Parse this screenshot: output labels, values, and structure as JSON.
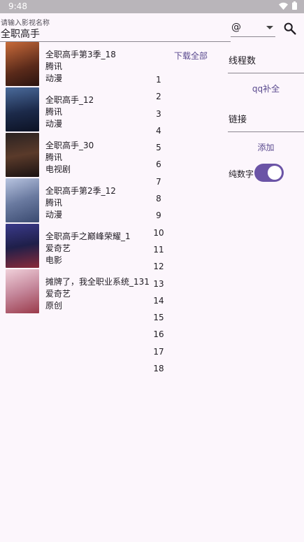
{
  "status_bar": {
    "time": "9:48"
  },
  "search": {
    "label": "请输入影视名称",
    "value": "全职高手"
  },
  "dropdown": {
    "selected": "@"
  },
  "download_all_label": "下载全部",
  "results": [
    {
      "title": "全职高手第3季_18",
      "source": "腾讯",
      "type": "动漫",
      "poster_color": "#7a3a22"
    },
    {
      "title": "全职高手_12",
      "source": "腾讯",
      "type": "动漫",
      "poster_color": "#1c2a4a"
    },
    {
      "title": "全职高手_30",
      "source": "腾讯",
      "type": "电视剧",
      "poster_color": "#3a2a2a"
    },
    {
      "title": "全职高手第2季_12",
      "source": "腾讯",
      "type": "动漫",
      "poster_color": "#6a7aa0"
    },
    {
      "title": "全职高手之巅峰荣耀_1",
      "source": "爱奇艺",
      "type": "电影",
      "poster_color": "#1f1f4a"
    },
    {
      "title": "摊牌了，我全职业系统_131",
      "source": "爱奇艺",
      "type": "原创",
      "poster_color": "#c4869a"
    }
  ],
  "episodes": [
    "1",
    "2",
    "3",
    "4",
    "5",
    "6",
    "7",
    "8",
    "9",
    "10",
    "11",
    "12",
    "13",
    "14",
    "15",
    "16",
    "17",
    "18"
  ],
  "right_panel": {
    "threads_label": "线程数",
    "qq_button": "qq补全",
    "link_label": "链接",
    "add_button": "添加",
    "toggle_label": "纯数字",
    "toggle_on": true
  },
  "colors": {
    "accent": "#6b54a6",
    "background": "#fcf6fc"
  }
}
